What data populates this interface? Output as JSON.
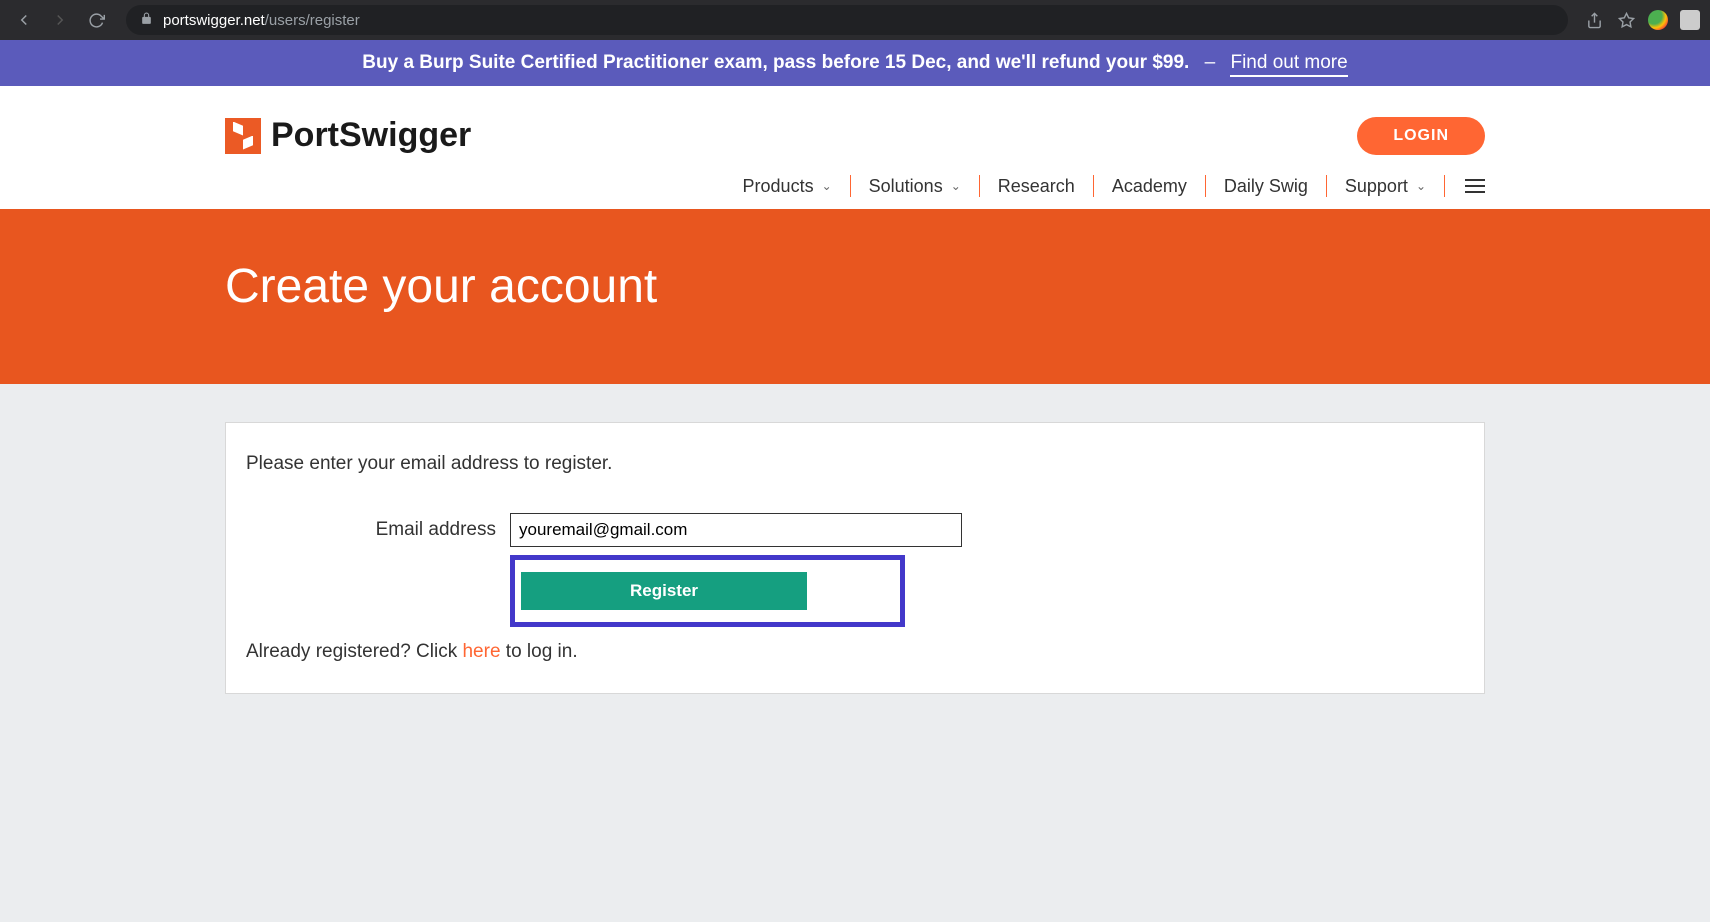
{
  "browser": {
    "url_domain": "portswigger.net",
    "url_path": "/users/register"
  },
  "promo": {
    "text": "Buy a Burp Suite Certified Practitioner exam, pass before 15 Dec, and we'll refund your $99.",
    "separator": "–",
    "link_text": "Find out more"
  },
  "header": {
    "logo_text": "PortSwigger",
    "login_label": "LOGIN",
    "nav": {
      "products": "Products",
      "solutions": "Solutions",
      "research": "Research",
      "academy": "Academy",
      "daily_swig": "Daily Swig",
      "support": "Support"
    }
  },
  "hero": {
    "title": "Create your account"
  },
  "form": {
    "intro": "Please enter your email address to register.",
    "email_label": "Email address",
    "email_value": "youremail@gmail.com",
    "register_label": "Register",
    "already_prefix": "Already registered? Click ",
    "already_link": "here",
    "already_suffix": " to log in."
  }
}
